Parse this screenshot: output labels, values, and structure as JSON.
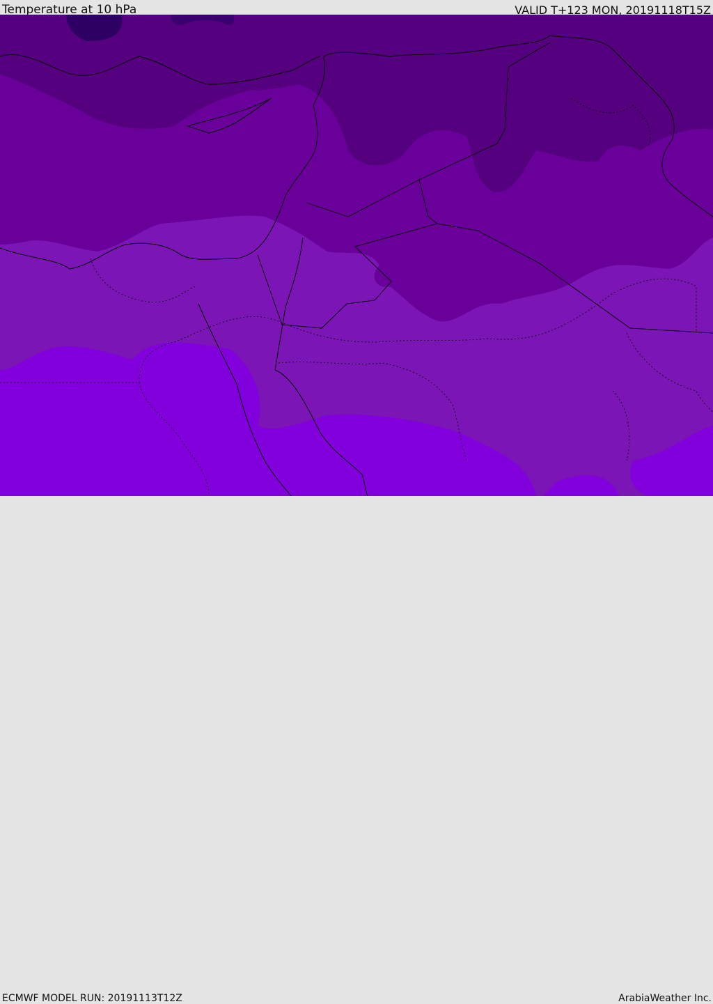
{
  "header": {
    "title": "Temperature at 10 hPa",
    "valid": "VALID T+123 MON, 20191118T15Z"
  },
  "footer": {
    "model_run": "ECMWF MODEL RUN: 20191113T12Z",
    "credit": "ArabiaWeather Inc."
  },
  "map": {
    "colors": {
      "darkest": "#2e0063",
      "level1": "#55007f",
      "level2": "#690099",
      "level3": "#7b15b5",
      "level4": "#8200db",
      "border": "#000000"
    }
  }
}
